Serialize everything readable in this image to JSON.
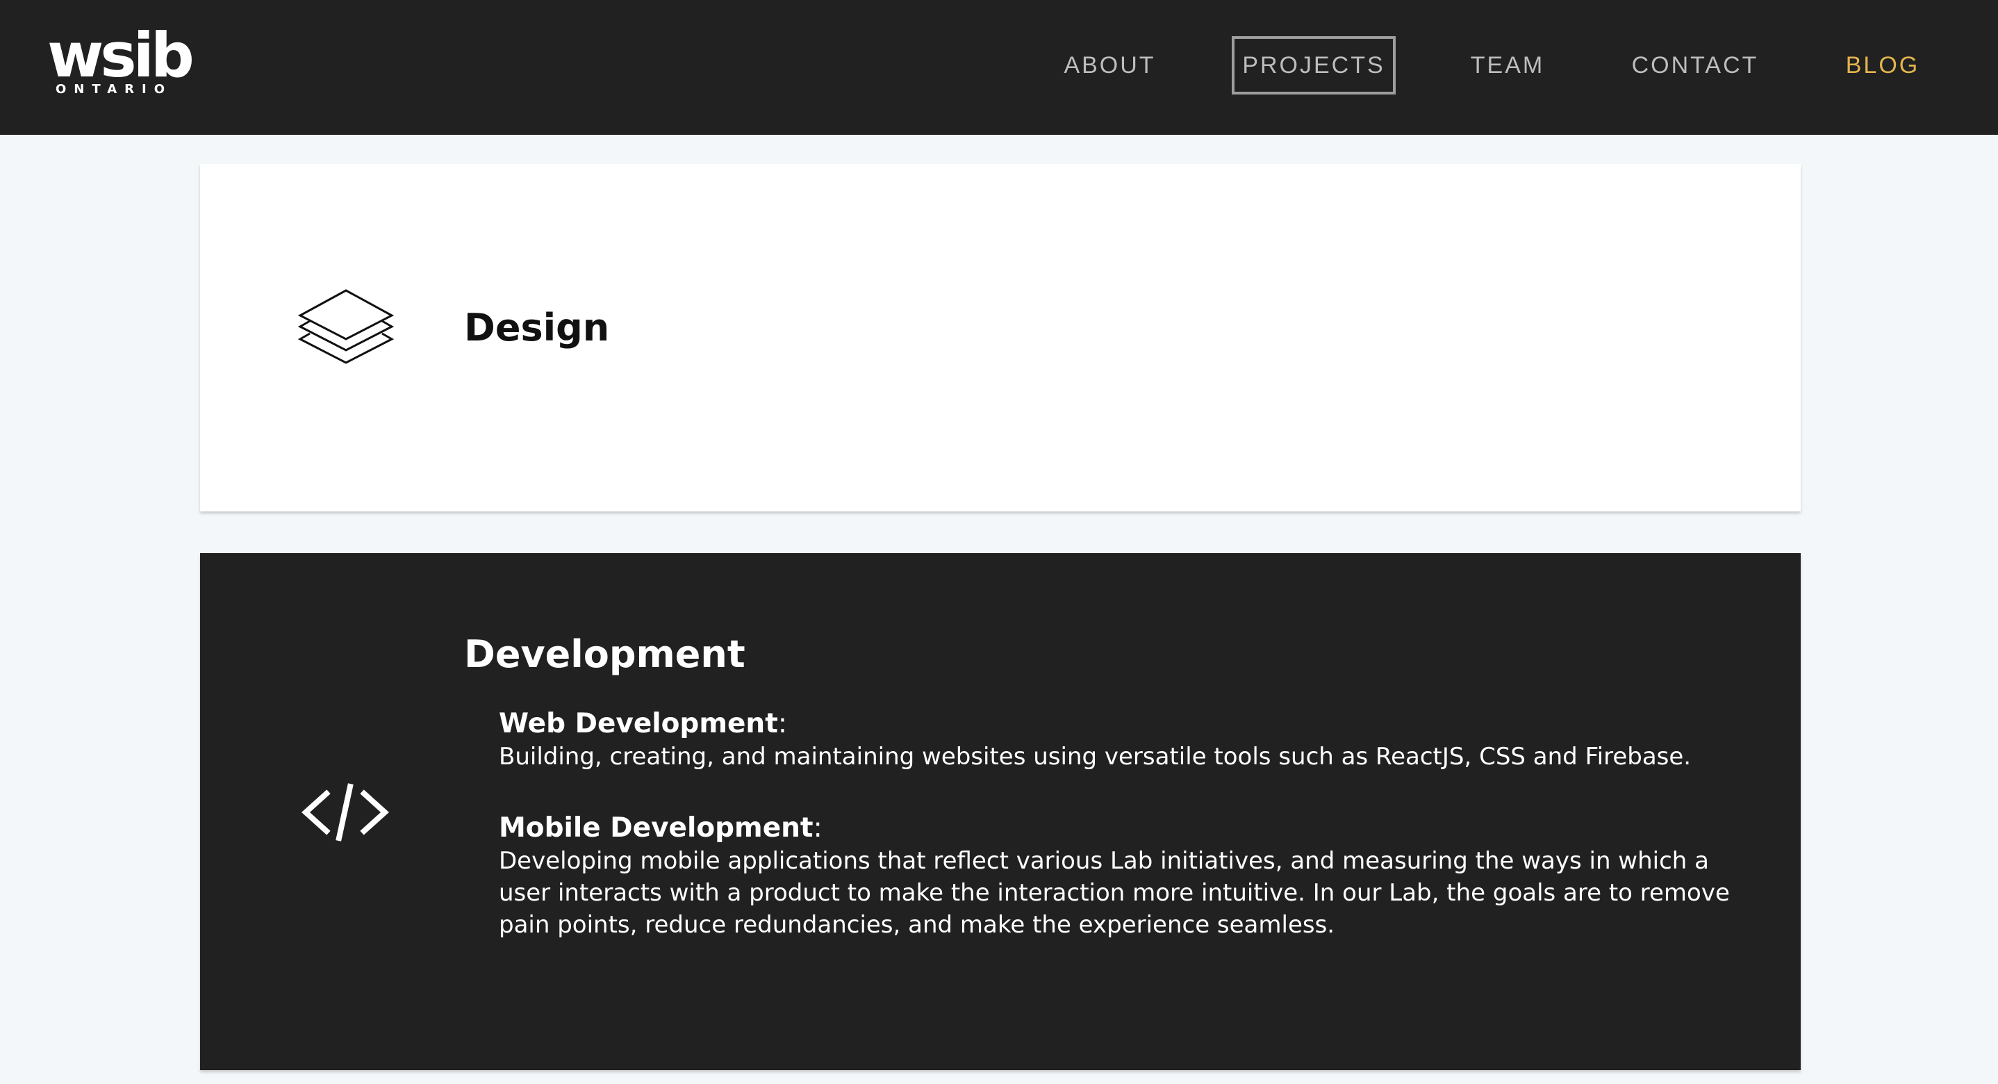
{
  "header": {
    "logo_main": "wsib",
    "logo_sub": "ONTARIO",
    "nav": {
      "about": "ABOUT",
      "projects": "PROJECTS",
      "team": "TEAM",
      "contact": "CONTACT",
      "blog": "BLOG"
    },
    "active_item": "PROJECTS",
    "colors": {
      "background": "#212121",
      "nav_text": "#bdbdbd",
      "blog_accent": "#e2b54d"
    }
  },
  "sections": {
    "design": {
      "title": "Design",
      "icon": "layers-icon"
    },
    "development": {
      "title": "Development",
      "icon": "code-icon",
      "web": {
        "heading": "Web Development",
        "colon": ":",
        "text": "Building, creating, and maintaining websites using versatile tools such as ReactJS, CSS and Firebase."
      },
      "mobile": {
        "heading": "Mobile Development",
        "colon": ":",
        "text": "Developing mobile applications that reflect various Lab initiatives, and measuring the ways in which a user interacts with a product to make the interaction more intuitive. In our Lab, the goals are to remove pain points, reduce redundancies, and make the experience seamless."
      }
    }
  }
}
